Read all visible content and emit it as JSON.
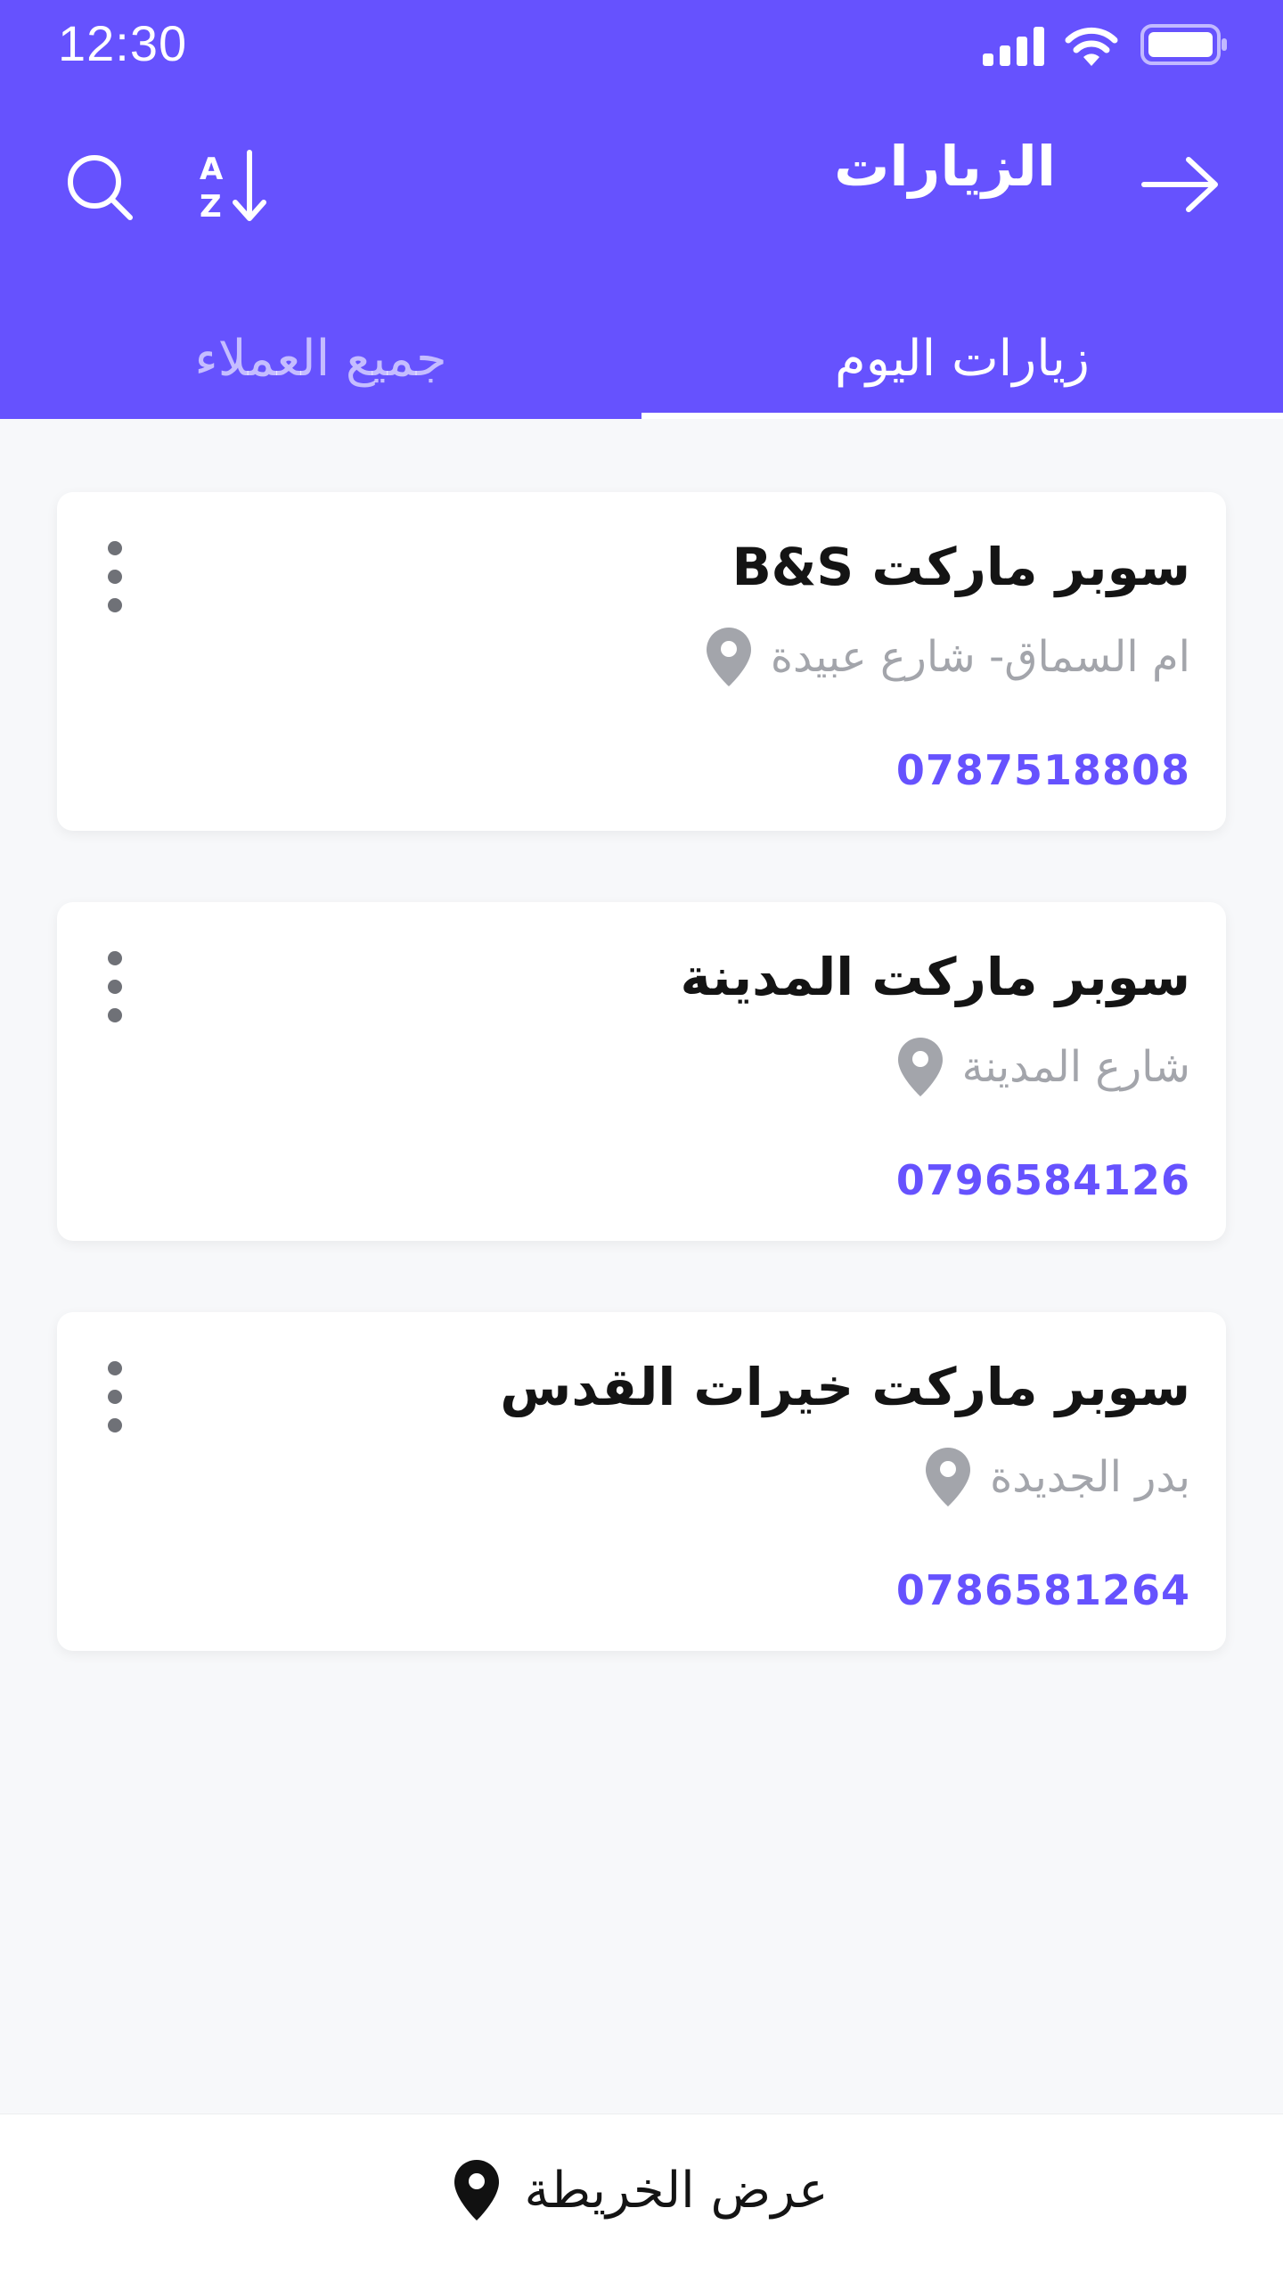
{
  "status_bar": {
    "time": "12:30"
  },
  "header": {
    "title": "الزيارات",
    "back_icon": "arrow-right-icon",
    "sort_icon": "sort-az-icon",
    "search_icon": "search-icon"
  },
  "tabs": [
    {
      "label": "زيارات اليوم",
      "active": true
    },
    {
      "label": "جميع العملاء",
      "active": false
    }
  ],
  "visits": [
    {
      "name": "سوبر ماركت B&S",
      "address": "ام السماق- شارع عبيدة",
      "phone": "0787518808"
    },
    {
      "name": "سوبر ماركت المدينة",
      "address": "شارع المدينة",
      "phone": "0796584126"
    },
    {
      "name": "سوبر ماركت خيرات القدس",
      "address": "بدر الجديدة",
      "phone": "0786581264"
    }
  ],
  "bottom_bar": {
    "map_label": "عرض الخريطة",
    "map_icon": "location-pin-icon"
  },
  "colors": {
    "primary": "#6652fe",
    "background": "#f7f8fa",
    "address_gray": "#a3a5ab",
    "card": "#ffffff"
  }
}
